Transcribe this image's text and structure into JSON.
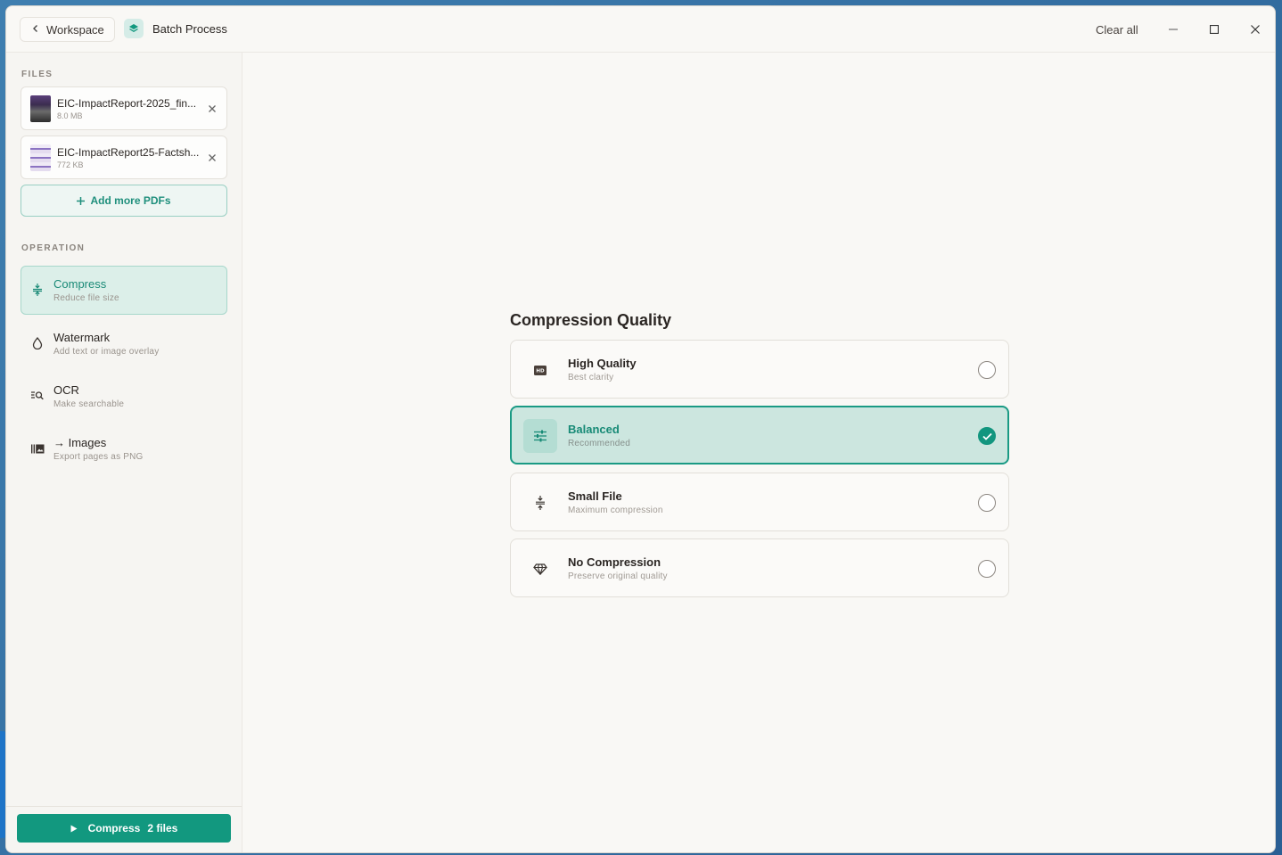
{
  "titlebar": {
    "back_label": "Workspace",
    "title": "Batch Process",
    "clear_all": "Clear all"
  },
  "sidebar": {
    "files_label": "FILES",
    "files": [
      {
        "name": "EIC-ImpactReport-2025_fin...",
        "size": "8.0 MB"
      },
      {
        "name": "EIC-ImpactReport25-Factsh...",
        "size": "772 KB"
      }
    ],
    "add_more": "Add more PDFs",
    "operation_label": "OPERATION",
    "operations": [
      {
        "title": "Compress",
        "subtitle": "Reduce file size",
        "icon": "compress-icon",
        "active": true
      },
      {
        "title": "Watermark",
        "subtitle": "Add text or image overlay",
        "icon": "droplet-icon",
        "active": false
      },
      {
        "title": "OCR",
        "subtitle": "Make searchable",
        "icon": "text-search-icon",
        "active": false
      },
      {
        "title": "→ Images",
        "subtitle": "Export pages as PNG",
        "icon": "image-stack-icon",
        "active": false
      }
    ],
    "run_button": {
      "action": "Compress",
      "count": "2 files"
    }
  },
  "main": {
    "title": "Compression Quality",
    "options": [
      {
        "title": "High Quality",
        "subtitle": "Best clarity",
        "icon": "hd-icon",
        "selected": false
      },
      {
        "title": "Balanced",
        "subtitle": "Recommended",
        "icon": "sliders-icon",
        "selected": true
      },
      {
        "title": "Small File",
        "subtitle": "Maximum compression",
        "icon": "compress-icon",
        "selected": false
      },
      {
        "title": "No Compression",
        "subtitle": "Preserve original quality",
        "icon": "gem-icon",
        "selected": false
      }
    ]
  },
  "colors": {
    "accent": "#12987f",
    "accent_light": "#dcefe9",
    "background": "#f9f8f5"
  }
}
